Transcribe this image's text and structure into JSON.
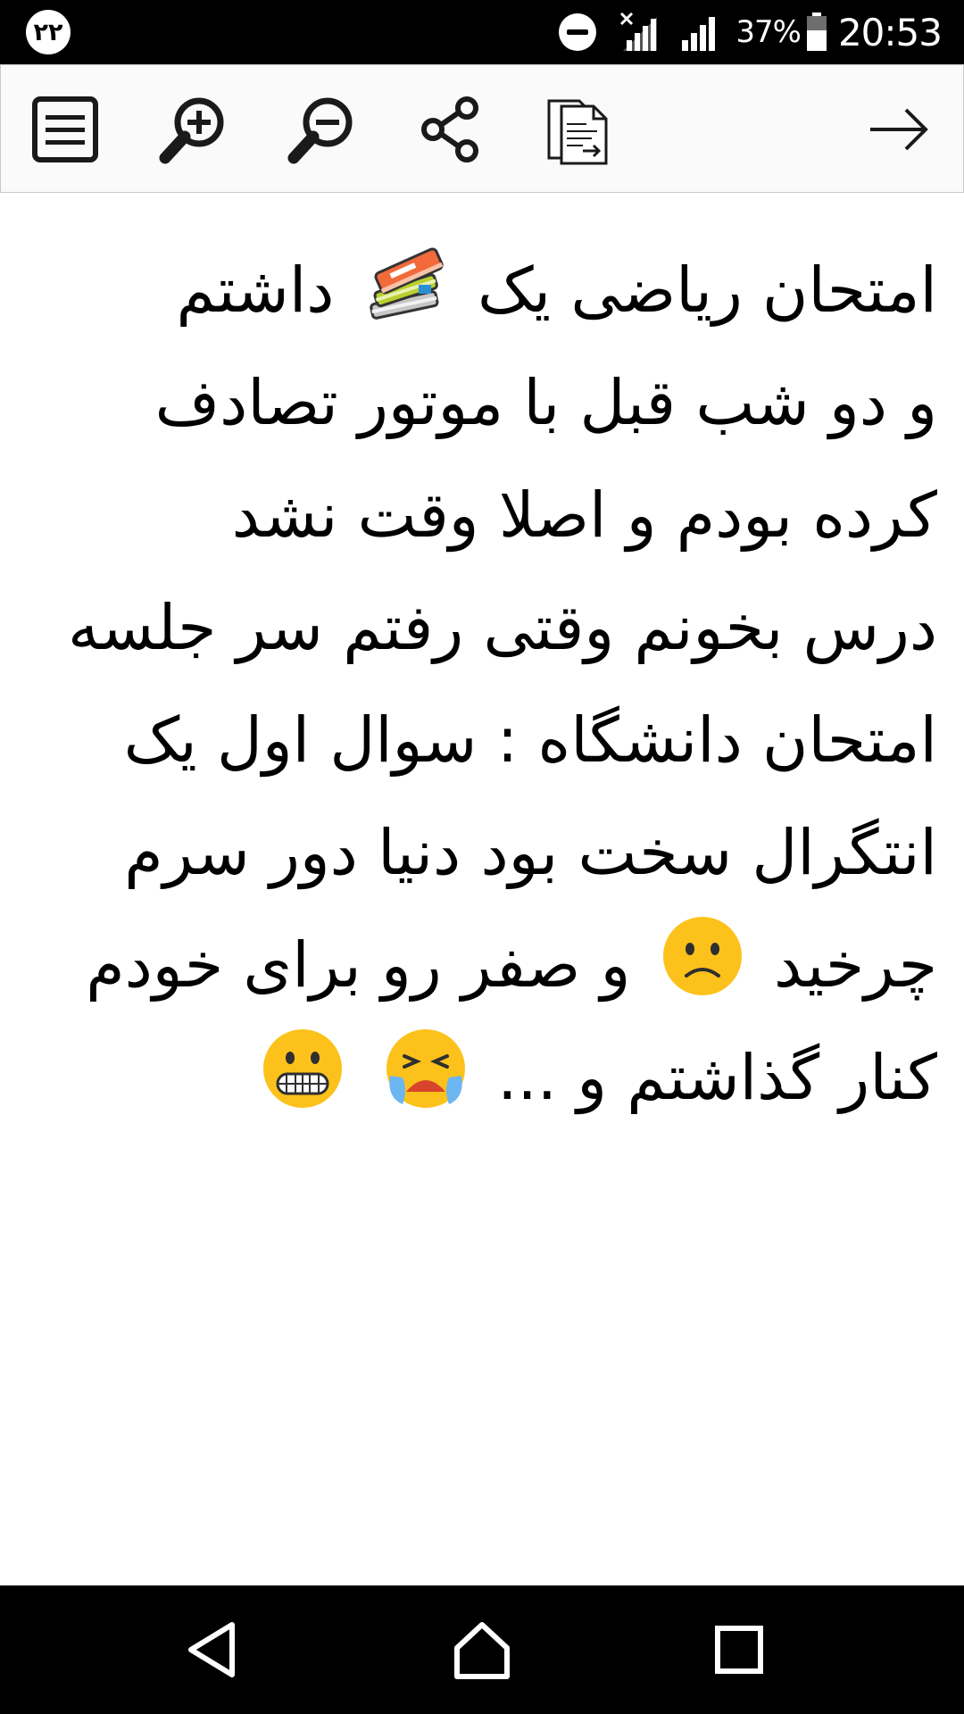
{
  "status_bar": {
    "notification_badge": "۲۲",
    "battery_percent": "37%",
    "time": "20:53",
    "icons": [
      "do-not-disturb-icon",
      "signal-no-data-icon",
      "signal-icon",
      "battery-icon"
    ]
  },
  "toolbar": {
    "buttons": [
      {
        "name": "menu-list-icon"
      },
      {
        "name": "zoom-in-icon"
      },
      {
        "name": "zoom-out-icon"
      },
      {
        "name": "share-icon"
      },
      {
        "name": "copy-document-icon"
      },
      {
        "name": "forward-arrow-icon"
      }
    ]
  },
  "content": {
    "lines": [
      {
        "parts": [
          "امتحان ریاضی یک",
          "داشتم"
        ],
        "emoji": [
          "books-emoji"
        ]
      },
      {
        "text": "و دو شب قبل با موتور تصادف"
      },
      {
        "text": "کرده بودم و اصلا وقت نشد"
      },
      {
        "text": "درس بخونم وقتی رفتم سر جلسه"
      },
      {
        "text": "امتحان دانشگاه : سوال اول یک"
      },
      {
        "text": "انتگرال سخت بود دنیا دور سرم"
      },
      {
        "parts": [
          "چرخید",
          "و صفر رو برای خودم"
        ],
        "emoji": [
          "worried-face-emoji"
        ]
      },
      {
        "parts": [
          "کنار گذاشتم و ..."
        ],
        "emoji": [
          "crying-face-emoji",
          "grimacing-face-emoji"
        ]
      }
    ]
  },
  "nav_bar": {
    "buttons": [
      "back-icon",
      "home-icon",
      "recents-icon"
    ]
  }
}
